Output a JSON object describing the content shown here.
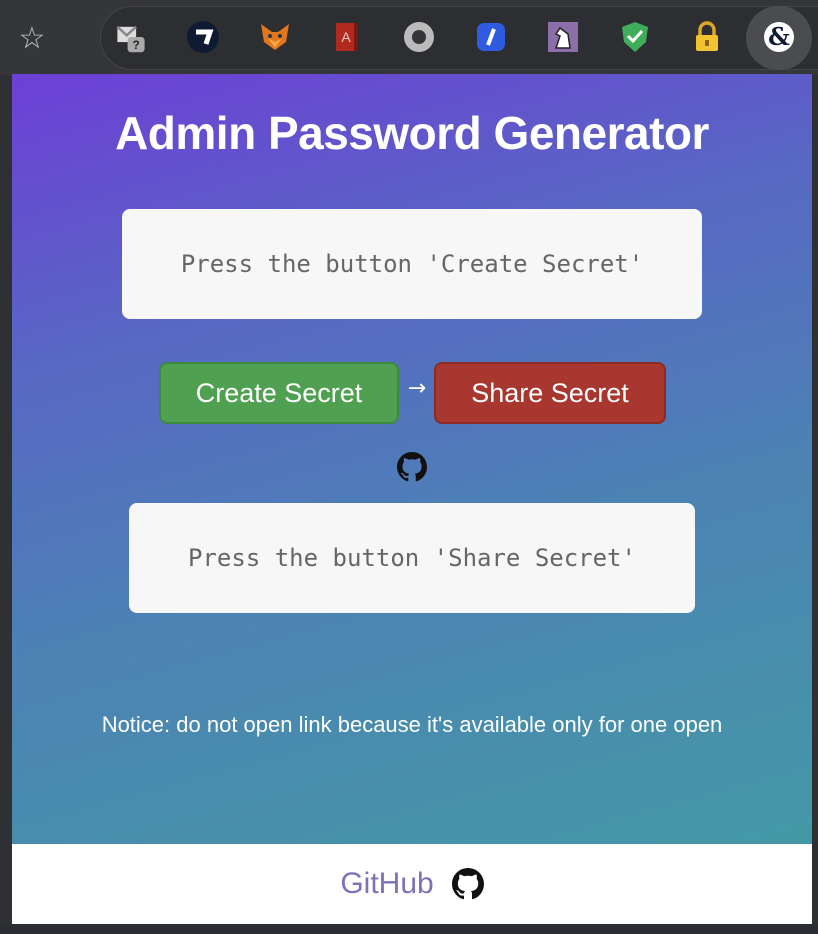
{
  "browser": {
    "star_glyph": "☆",
    "extensions": [
      {
        "icon": "gmail-help-icon"
      },
      {
        "icon": "dark-circle-arrow-icon"
      },
      {
        "icon": "metamask-fox-icon"
      },
      {
        "icon": "acrobat-book-icon"
      },
      {
        "icon": "ring-icon"
      },
      {
        "icon": "blue-slash-icon"
      },
      {
        "icon": "chess-knight-icon"
      },
      {
        "icon": "green-shield-check-icon"
      },
      {
        "icon": "lock-icon"
      },
      {
        "icon": "ampersand-extension-icon"
      }
    ]
  },
  "popup": {
    "title": "Admin Password Generator",
    "secret_box_text": "Press the button 'Create Secret'",
    "create_button": "Create Secret",
    "arrow": "→",
    "share_button": "Share Secret",
    "share_box_text": "Press the button 'Share Secret'",
    "notice": "Notice: do not open link because it's available only for one open"
  },
  "footer": {
    "link_text": "GitHub"
  },
  "colors": {
    "gradient_start": "#6d3fd6",
    "gradient_end": "#4499a6",
    "create_green": "#4fa050",
    "share_red": "#a7372f",
    "link_purple": "#7b72b8"
  }
}
